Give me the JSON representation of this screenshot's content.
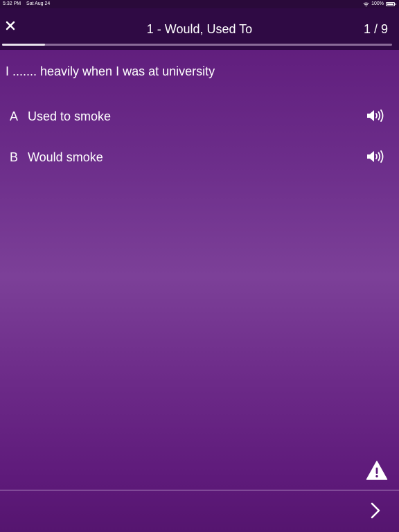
{
  "status_bar": {
    "time": "5:32 PM",
    "date": "Sat Aug 24",
    "battery": "100%",
    "icons": [
      "wifi-icon",
      "battery-icon"
    ]
  },
  "header": {
    "close_icon": "close-icon",
    "title": "1 - Would, Used To",
    "counter": "1 / 9",
    "progress_fraction": 0.11
  },
  "question": {
    "text": "I ....... heavily when I was at university"
  },
  "options": [
    {
      "letter": "A",
      "text": "Used to smoke",
      "icon": "speaker-icon"
    },
    {
      "letter": "B",
      "text": "Would smoke",
      "icon": "speaker-icon"
    }
  ],
  "footer": {
    "report_icon": "warning-icon",
    "next_icon": "chevron-right-icon"
  },
  "colors": {
    "header_bg": "#2f0a44",
    "status_bg": "#2a0a3a",
    "gradient_mid": "#7c4098",
    "gradient_edge": "#5c1878",
    "text": "#ffffff"
  }
}
